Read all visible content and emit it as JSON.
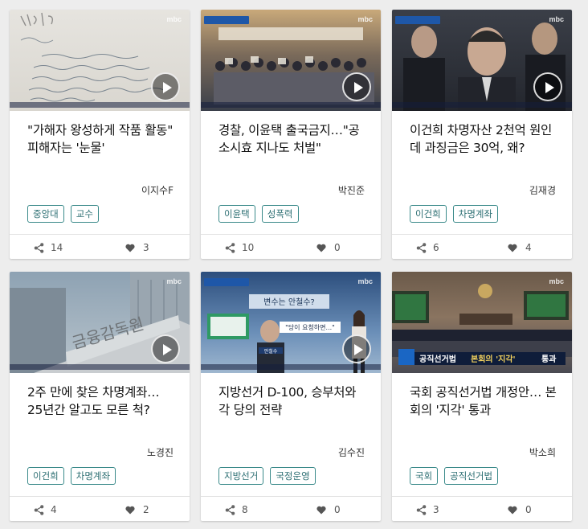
{
  "cards": [
    {
      "title": "\"가해자 왕성하게 작품 활동\" 피해자는 '눈물'",
      "author": "이지수F",
      "tags": [
        "중앙대",
        "교수"
      ],
      "share_count": "14",
      "like_count": "3",
      "thumb_kind": "letter"
    },
    {
      "title": "경찰, 이윤택 출국금지…\"공소시효 지나도 처벌\"",
      "author": "박진준",
      "tags": [
        "이윤택",
        "성폭력"
      ],
      "share_count": "10",
      "like_count": "0",
      "thumb_kind": "rally"
    },
    {
      "title": "이건희 차명자산 2천억 원인데 과징금은 30억, 왜?",
      "author": "김재경",
      "tags": [
        "이건희",
        "차명계좌"
      ],
      "share_count": "6",
      "like_count": "4",
      "thumb_kind": "portrait"
    },
    {
      "title": "2주 만에 찾은 차명계좌… 25년간 알고도 모른 척?",
      "author": "노경진",
      "tags": [
        "이건희",
        "차명계좌"
      ],
      "share_count": "4",
      "like_count": "2",
      "thumb_kind": "building"
    },
    {
      "title": "지방선거 D-100, 승부처와 각 당의 전략",
      "author": "김수진",
      "tags": [
        "지방선거",
        "국정운영"
      ],
      "share_count": "8",
      "like_count": "0",
      "thumb_kind": "studio"
    },
    {
      "title": "국회 공직선거법 개정안… 본회의 '지각' 통과",
      "author": "박소희",
      "tags": [
        "국회",
        "공직선거법"
      ],
      "share_count": "3",
      "like_count": "0",
      "thumb_kind": "assembly"
    }
  ],
  "thumbnail_text": {
    "building_sign": "금융감독원",
    "studio_headline": "변수는 안철수?",
    "studio_quote": "\"당이 요청하면...\"",
    "studio_name": "안철수",
    "assembly_caption_prefix": "공직선거법",
    "assembly_caption_highlight": "본회의 '지각'",
    "assembly_caption_suffix": "통과"
  },
  "watermark": "mbc",
  "colors": {
    "tag_border": "#3a8a8a",
    "tag_text": "#2d6f73",
    "background": "#ededed",
    "news_bar": "#1e57a8"
  }
}
